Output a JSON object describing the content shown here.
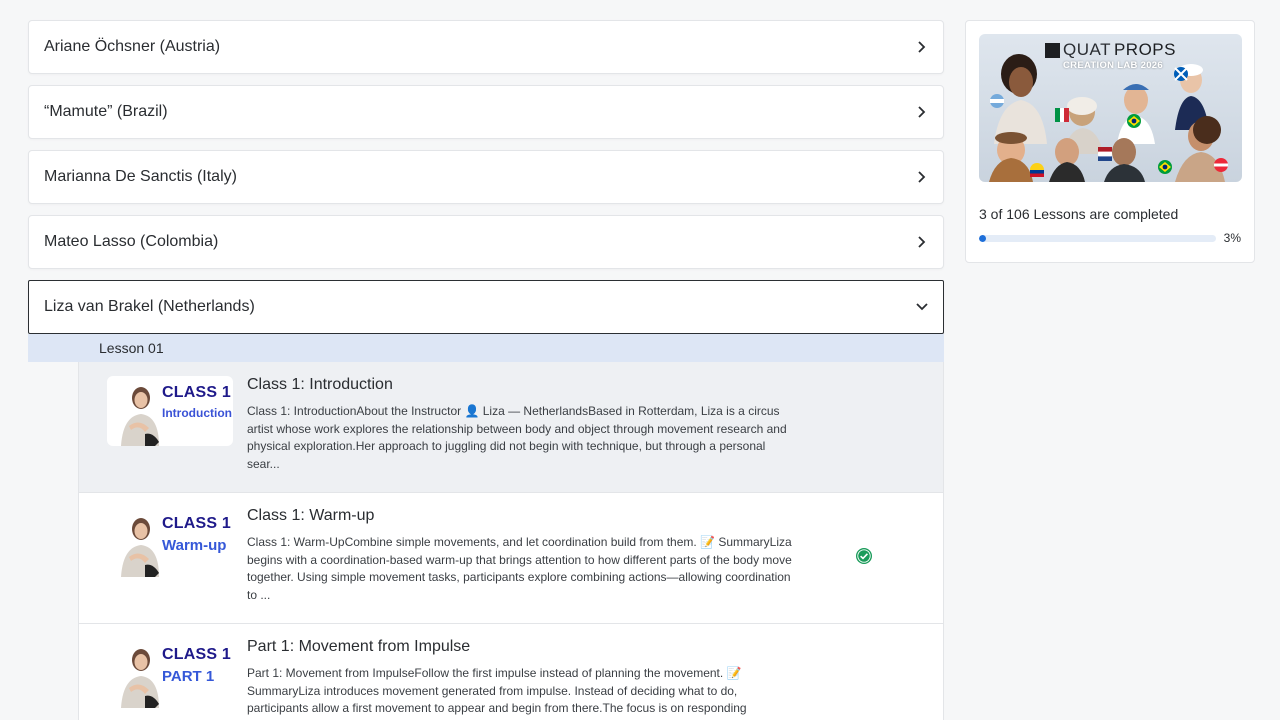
{
  "accordion": {
    "items": [
      {
        "label": "Ariane Öchsner (Austria)"
      },
      {
        "label": "“Mamute” (Brazil)"
      },
      {
        "label": "Marianna De Sanctis (Italy)"
      },
      {
        "label": "Mateo Lasso (Colombia)"
      }
    ],
    "open_item": {
      "label": "Liza van Brakel (Netherlands)"
    }
  },
  "lesson_group": {
    "label": "Lesson 01"
  },
  "lessons": [
    {
      "title": "Class 1: Introduction",
      "thumb_line1": "CLASS 1",
      "thumb_line2": "Introduction",
      "description": "Class 1: IntroductionAbout the Instructor 👤 Liza — NetherlandsBased in Rotterdam, Liza is a circus artist whose work explores the relationship between body and object through movement research and physical exploration.Her approach to juggling did not begin with technique, but through a personal sear...",
      "completed": false
    },
    {
      "title": "Class 1: Warm-up",
      "thumb_line1": "CLASS 1",
      "thumb_line2": "Warm-up",
      "description": "Class 1: Warm-UpCombine simple movements, and let coordination build from them. 📝 SummaryLiza begins with a coordination-based warm-up that brings attention to how different parts of the body move together. Using simple movement tasks, participants explore combining actions—allowing coordination to ...",
      "completed": true
    },
    {
      "title": "Part 1: Movement from Impulse",
      "thumb_line1": "CLASS 1",
      "thumb_line2": "PART 1",
      "description": "Part 1: Movement from ImpulseFollow the first impulse instead of planning the movement. 📝 SummaryLiza introduces movement generated from impulse. Instead of deciding what to do, participants allow a first movement to appear and begin from there.The focus is on responding",
      "completed": false
    }
  ],
  "sidebar": {
    "banner_brand_a": "QUAT",
    "banner_brand_b": "PROPS",
    "banner_subtitle": "CREATION LAB 2026",
    "progress_text": "3 of 106 Lessons are completed",
    "progress_percent_label": "3%",
    "progress_fraction": 0.03
  },
  "colors": {
    "accent": "#1e6fd9",
    "completed": "#1a9b5a",
    "lesson_header_bg": "#dde6f5"
  }
}
